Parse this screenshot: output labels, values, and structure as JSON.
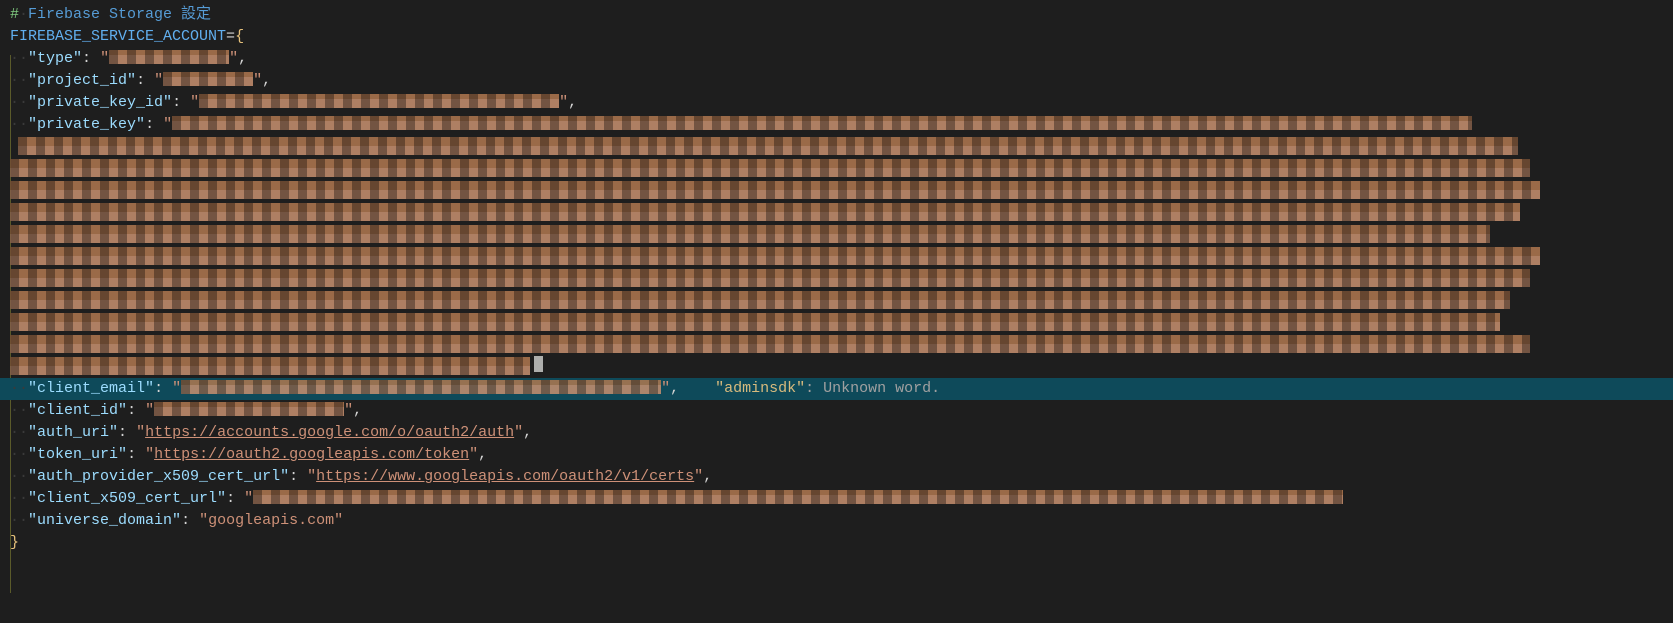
{
  "comment": {
    "hash": "#",
    "text": "Firebase Storage 設定"
  },
  "env": {
    "name": "FIREBASE_SERVICE_ACCOUNT",
    "equals": "=",
    "open_brace": "{",
    "close_brace": "}"
  },
  "fields": {
    "type": {
      "key": "\"type\"",
      "colon": ": ",
      "openq": "\"",
      "closeq": "\"",
      "comma": ","
    },
    "project_id": {
      "key": "\"project_id\"",
      "colon": ": ",
      "openq": "\"",
      "closeq": "\"",
      "comma": ","
    },
    "private_key_id": {
      "key": "\"private_key_id\"",
      "colon": ": ",
      "openq": "\"",
      "closeq": "\"",
      "comma": ","
    },
    "private_key": {
      "key": "\"private_key\"",
      "colon": ": ",
      "openq": "\""
    },
    "client_email": {
      "key": "\"client_email\"",
      "colon": ": ",
      "openq": "\"",
      "closeq": "\"",
      "comma": ","
    },
    "client_id": {
      "key": "\"client_id\"",
      "colon": ": ",
      "openq": "\"",
      "closeq": "\"",
      "comma": ","
    },
    "auth_uri": {
      "key": "\"auth_uri\"",
      "colon": ": ",
      "openq": "\"",
      "value": "https://accounts.google.com/o/oauth2/auth",
      "closeq": "\"",
      "comma": ","
    },
    "token_uri": {
      "key": "\"token_uri\"",
      "colon": ": ",
      "openq": "\"",
      "value": "https://oauth2.googleapis.com/token",
      "closeq": "\"",
      "comma": ","
    },
    "auth_provider_x509_cert_url": {
      "key": "\"auth_provider_x509_cert_url\"",
      "colon": ": ",
      "openq": "\"",
      "value": "https://www.googleapis.com/oauth2/v1/certs",
      "closeq": "\"",
      "comma": ","
    },
    "client_x509_cert_url": {
      "key": "\"client_x509_cert_url\"",
      "colon": ": ",
      "openq": "\""
    },
    "universe_domain": {
      "key": "\"universe_domain\"",
      "colon": ": ",
      "openq": "\"",
      "value": "googleapis.com",
      "closeq": "\""
    }
  },
  "diagnostic": {
    "word": "\"adminsdk\"",
    "message": ": Unknown word."
  },
  "indent2": "  "
}
